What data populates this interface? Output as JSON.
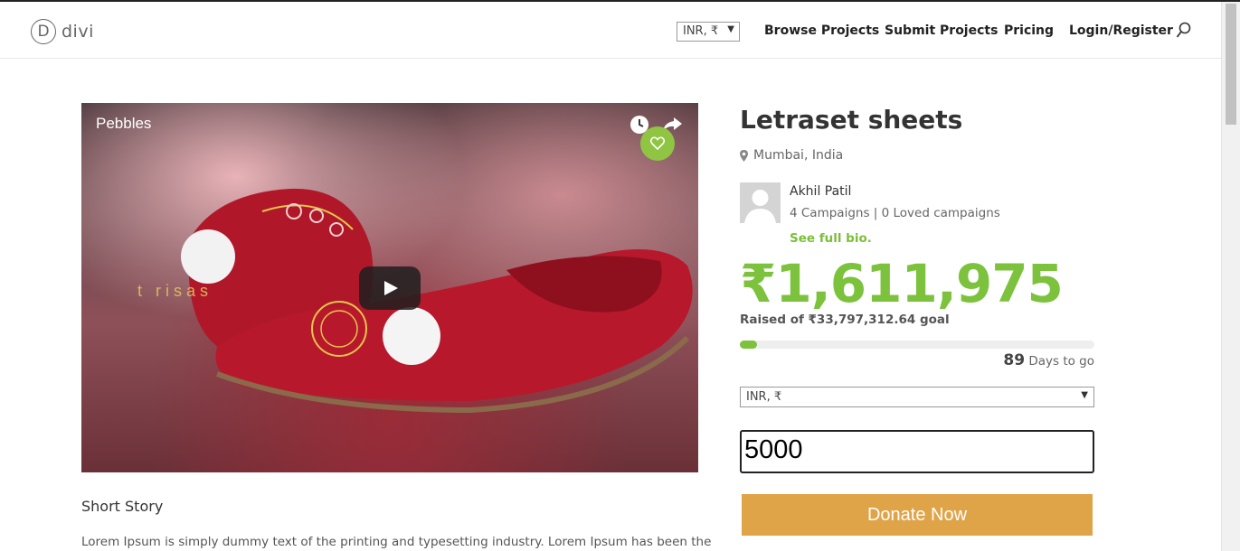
{
  "header": {
    "logo_text": "divi",
    "logo_letter": "D",
    "currency_select": "INR, ₹",
    "nav": [
      "Browse Projects",
      "Submit Projects",
      "Pricing",
      "Login/Register"
    ]
  },
  "video": {
    "title": "Pebbles",
    "overlay_text": "t risas",
    "icons": [
      "clock-icon",
      "share-icon",
      "heart-icon",
      "play-icon"
    ]
  },
  "story": {
    "heading": "Short Story",
    "text": "Lorem Ipsum is simply dummy text of the printing and typesetting industry. Lorem Ipsum has been the"
  },
  "campaign": {
    "title": "Letraset sheets",
    "location": "Mumbai, India",
    "author_name": "Akhil Patil",
    "author_stats": "4 Campaigns | 0 Loved campaigns",
    "bio_link": "See full bio.",
    "raised": "₹1,611,975",
    "goal_text": "Raised of ₹33,797,312.64 goal",
    "progress_fraction": 0.048,
    "days_number": "89",
    "days_label": "Days to go",
    "currency_select": "INR, ₹",
    "amount_value": "5000",
    "donate_label": "Donate Now"
  },
  "colors": {
    "accent_green": "#7cc23d",
    "donate_orange": "#e0a448",
    "heart_green": "#8fc542"
  }
}
